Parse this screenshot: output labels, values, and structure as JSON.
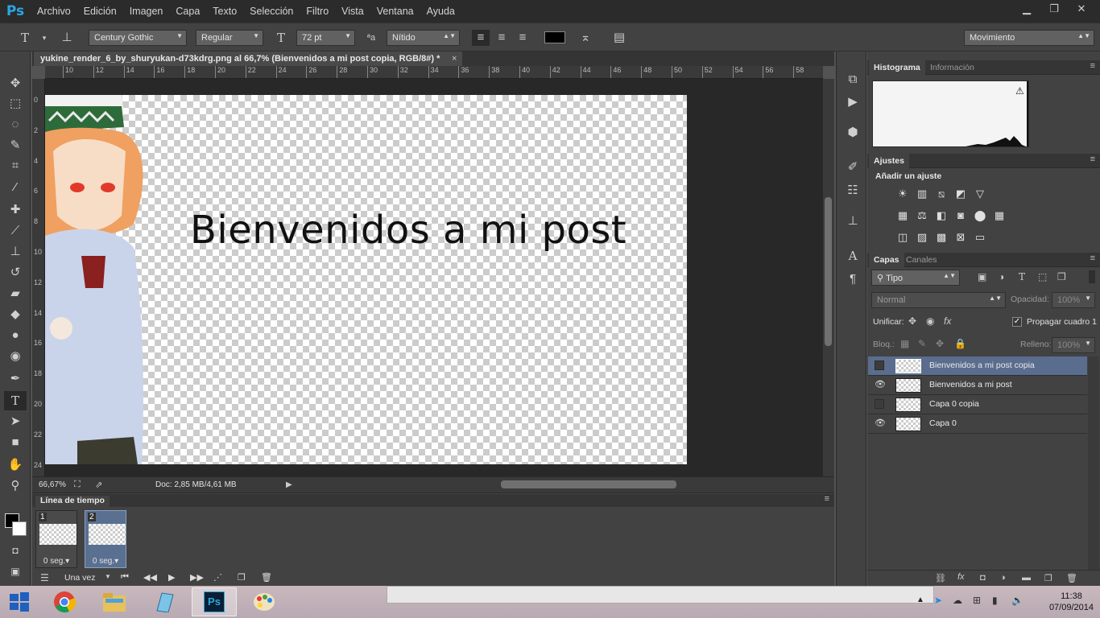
{
  "app": {
    "logo": "Ps"
  },
  "menu": [
    "Archivo",
    "Edición",
    "Imagen",
    "Capa",
    "Texto",
    "Selección",
    "Filtro",
    "Vista",
    "Ventana",
    "Ayuda"
  ],
  "window_controls": {
    "minimize": "▁",
    "restore": "❐",
    "close": "✕"
  },
  "options": {
    "font_family": "Century Gothic",
    "font_style": "Regular",
    "font_size": "72 pt",
    "antialias_icon": "ªa",
    "antialias": "Nítido",
    "text_color": "#000000",
    "workspace": "Movimiento"
  },
  "document": {
    "tab_title": "yukine_render_6_by_shuryukan-d73kdrg.png al 66,7% (Bienvenidos a mi post copia, RGB/8#) *",
    "close": "×",
    "canvas_text": "Bienvenidos a mi post",
    "ruler_top": [
      "10",
      "12",
      "14",
      "16",
      "18",
      "20",
      "22",
      "24",
      "26",
      "28",
      "30",
      "32",
      "34",
      "36",
      "38",
      "40",
      "42",
      "44",
      "46",
      "48",
      "50",
      "52",
      "54",
      "56",
      "58"
    ],
    "ruler_left": [
      "0",
      "2",
      "4",
      "6",
      "8",
      "10",
      "12",
      "14",
      "16",
      "18",
      "20",
      "22",
      "24"
    ]
  },
  "status": {
    "zoom": "66,67%",
    "doc": "Doc: 2,85 MB/4,61 MB"
  },
  "timeline": {
    "title": "Línea de tiempo",
    "frames": [
      {
        "num": "1",
        "delay": "0 seg.▾"
      },
      {
        "num": "2",
        "delay": "0 seg.▾"
      }
    ],
    "loop": "Una vez"
  },
  "panels": {
    "histogram_tabs": [
      "Histograma",
      "Información"
    ],
    "adjustments_tab": "Ajustes",
    "adjustments_title": "Añadir un ajuste",
    "layers_tabs": [
      "Capas",
      "Canales"
    ],
    "filter_kind": "Tipo",
    "blend_mode": "Normal",
    "opacity_label": "Opacidad:",
    "opacity": "100%",
    "unify_label": "Unificar:",
    "propagate_label": "Propagar cuadro 1",
    "lock_label": "Bloq.:",
    "fill_label": "Relleno:",
    "fill": "100%",
    "layers": [
      {
        "name": "Bienvenidos a mi post copia",
        "visible": false,
        "selected": true
      },
      {
        "name": "Bienvenidos a mi post",
        "visible": true,
        "selected": false
      },
      {
        "name": "Capa 0 copia",
        "visible": false,
        "selected": false
      },
      {
        "name": "Capa 0",
        "visible": true,
        "selected": false
      }
    ]
  },
  "taskbar": {
    "time": "11:38",
    "date": "07/09/2014"
  },
  "colors": {
    "accent": "#29a8e0",
    "selection": "#5a6d8e",
    "bg": "#535353"
  }
}
